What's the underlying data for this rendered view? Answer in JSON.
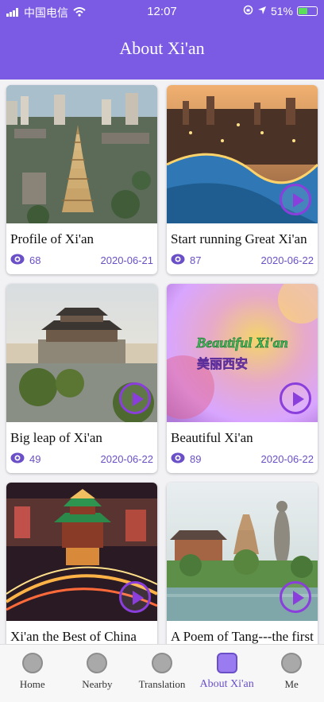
{
  "status": {
    "carrier": "中国电信",
    "time": "12:07",
    "battery": "51%",
    "battery_level": 0.51
  },
  "header": {
    "title": "About Xi'an"
  },
  "cards": [
    {
      "title": "Profile of Xi'an",
      "views": "68",
      "date": "2020-06-21",
      "has_video": false
    },
    {
      "title": "Start running Great Xi'an",
      "views": "87",
      "date": "2020-06-22",
      "has_video": true
    },
    {
      "title": "Big leap of Xi'an",
      "views": "49",
      "date": "2020-06-22",
      "has_video": true
    },
    {
      "title": "Beautiful Xi'an",
      "views": "89",
      "date": "2020-06-22",
      "has_video": true,
      "thumb_text": "Beautiful Xi'an",
      "thumb_text_cn": "美丽西安"
    },
    {
      "title": "Xi'an the Best of China",
      "views": "",
      "date": "",
      "has_video": true
    },
    {
      "title": "A Poem of Tang---the first",
      "views": "",
      "date": "",
      "has_video": true
    }
  ],
  "tabs": [
    {
      "label": "Home"
    },
    {
      "label": "Nearby"
    },
    {
      "label": "Translation"
    },
    {
      "label": "About Xi'an"
    },
    {
      "label": "Me"
    }
  ],
  "colors": {
    "accent": "#7b5be3",
    "play": "#8a3fdc",
    "meta": "#6a4fc7"
  }
}
